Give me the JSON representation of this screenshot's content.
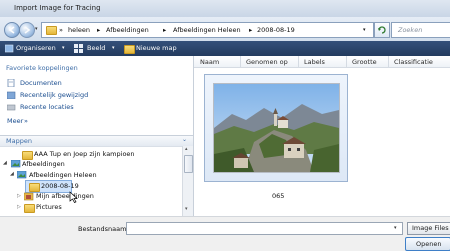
{
  "window": {
    "title": "Import Image for Tracing"
  },
  "navbar": {
    "breadcrumbs": [
      "heleen",
      "Afbeeldingen",
      "Afbeeldingen Heleen",
      "2008-08-19"
    ],
    "search_placeholder": "Zoeken"
  },
  "toolbar": {
    "organize": "Organiseren",
    "view": "Beeld",
    "new_folder": "Nieuwe map"
  },
  "sidebar": {
    "favorites_title": "Favoriete koppelingen",
    "favorites": [
      "Documenten",
      "Recentelijk gewijzigd",
      "Recente locaties"
    ],
    "more": "Meer",
    "folders_title": "Mappen",
    "tree": [
      "AAA Tup en Joep zijn kampioen",
      "Afbeeldingen",
      "Afbeeldingen Heleen",
      "2008-08-19",
      "Mijn afbeeldingen",
      "Pictures"
    ]
  },
  "columns": [
    "Naam",
    "Genomen op",
    "Labels",
    "Grootte",
    "Classificatie"
  ],
  "files": [
    {
      "name": "065"
    }
  ],
  "footer": {
    "filename_label": "Bestandsnaam:",
    "filename_value": "",
    "filter": "Image Files",
    "open": "Openen"
  },
  "colors": {
    "toolbar": "#2b4468",
    "selection": "#cfe3fb",
    "accent": "#3f6ea8"
  },
  "icons": [
    "back-arrow-icon",
    "forward-arrow-icon",
    "folder-icon",
    "refresh-icon",
    "search-icon",
    "documents-icon",
    "recent-icon",
    "locations-icon",
    "mouse-cursor-icon"
  ]
}
